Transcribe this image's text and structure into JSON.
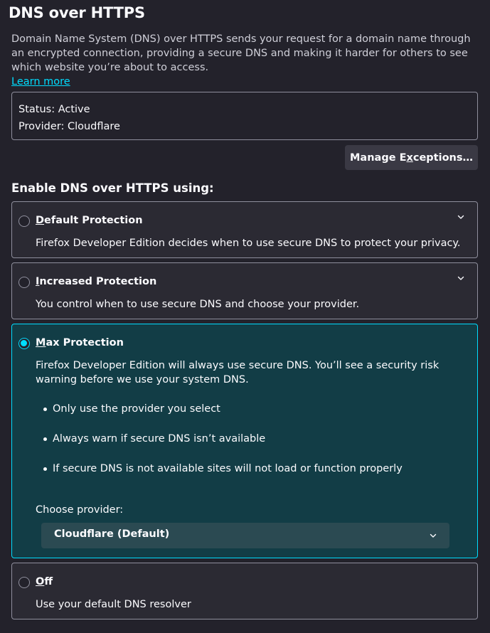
{
  "header": {
    "title": "DNS over HTTPS",
    "intro": "Domain Name System (DNS) over HTTPS sends your request for a domain name through an encrypted connection, providing a secure DNS and making it harder for others to see which website you’re about to access.",
    "learn_more": "Learn more"
  },
  "status": {
    "status_line": "Status: Active",
    "provider_line": "Provider: Cloudflare"
  },
  "manage": {
    "label_pre": "Manage E",
    "label_access": "x",
    "label_post": "ceptions…"
  },
  "section": {
    "heading": "Enable DNS over HTTPS using:"
  },
  "options": [
    {
      "access": "D",
      "rest": "efault Protection",
      "description": "Firefox Developer Edition decides when to use secure DNS to protect your privacy.",
      "selected": false
    },
    {
      "access": "I",
      "rest": "ncreased Protection",
      "description": "You control when to use secure DNS and choose your provider.",
      "selected": false
    },
    {
      "access": "M",
      "rest": "ax Protection",
      "description": "Firefox Developer Edition will always use secure DNS. You’ll see a security risk warning before we use your system DNS.",
      "selected": true,
      "bullets": [
        "Only use the provider you select",
        "Always warn if secure DNS isn’t available",
        "If secure DNS is not available sites will not load or function properly"
      ],
      "provider_label": "Choose provider:",
      "provider_value": "Cloudflare (Default)"
    },
    {
      "access": "O",
      "rest": "ff",
      "description": "Use your default DNS resolver",
      "selected": false
    }
  ],
  "colors": {
    "background": "#23222b",
    "accent": "#00ddff",
    "selected_bg": "#123d46",
    "border": "#8f8f9d"
  },
  "icons": {
    "chevron": "chevron-down-icon"
  }
}
